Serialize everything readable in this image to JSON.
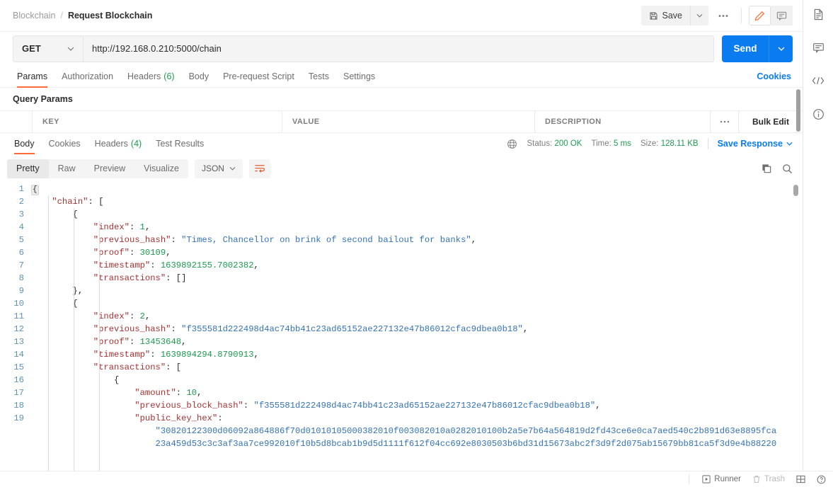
{
  "header": {
    "breadcrumb_parent": "Blockchain",
    "breadcrumb_separator": "/",
    "breadcrumb_current": "Request Blockchain",
    "save_label": "Save",
    "more_label": "●●●",
    "edit_icon": "pencil-icon",
    "comment_icon": "comment-icon"
  },
  "request": {
    "method": "GET",
    "url": "http://192.168.0.210:5000/chain",
    "send_label": "Send",
    "tabs": [
      {
        "label": "Params",
        "count": "",
        "active": true
      },
      {
        "label": "Authorization",
        "count": "",
        "active": false
      },
      {
        "label": "Headers",
        "count": "(6)",
        "active": false
      },
      {
        "label": "Body",
        "count": "",
        "active": false
      },
      {
        "label": "Pre-request Script",
        "count": "",
        "active": false
      },
      {
        "label": "Tests",
        "count": "",
        "active": false
      },
      {
        "label": "Settings",
        "count": "",
        "active": false
      }
    ],
    "cookies_link": "Cookies"
  },
  "query_params": {
    "title": "Query Params",
    "columns": [
      "KEY",
      "VALUE",
      "DESCRIPTION"
    ],
    "bulk_edit": "Bulk Edit",
    "dots": "●●●",
    "rows": []
  },
  "response": {
    "tabs": [
      {
        "label": "Body",
        "count": "",
        "active": true
      },
      {
        "label": "Cookies",
        "count": "",
        "active": false
      },
      {
        "label": "Headers",
        "count": "(4)",
        "active": false
      },
      {
        "label": "Test Results",
        "count": "",
        "active": false
      }
    ],
    "status_label": "Status:",
    "status_value": "200 OK",
    "time_label": "Time:",
    "time_value": "5 ms",
    "size_label": "Size:",
    "size_value": "128.11 KB",
    "save_response": "Save Response",
    "format_tabs": [
      {
        "label": "Pretty",
        "active": true
      },
      {
        "label": "Raw",
        "active": false
      },
      {
        "label": "Preview",
        "active": false
      },
      {
        "label": "Visualize",
        "active": false
      }
    ],
    "content_type": "JSON",
    "wrap_icon": "word-wrap-icon",
    "copy_icon": "copy-icon",
    "search_icon": "search-icon",
    "globe_icon": "globe-icon"
  },
  "body_lines": [
    {
      "num": "1",
      "indent": 0,
      "fold": "{"
    },
    {
      "num": "2",
      "indent": 1,
      "tokens": [
        {
          "t": "k",
          "v": "\"chain\""
        },
        {
          "t": "p",
          "v": ": ["
        }
      ]
    },
    {
      "num": "3",
      "indent": 2,
      "tokens": [
        {
          "t": "p",
          "v": "{"
        }
      ]
    },
    {
      "num": "4",
      "indent": 3,
      "tokens": [
        {
          "t": "k",
          "v": "\"index\""
        },
        {
          "t": "p",
          "v": ": "
        },
        {
          "t": "n",
          "v": "1"
        },
        {
          "t": "p",
          "v": ","
        }
      ]
    },
    {
      "num": "5",
      "indent": 3,
      "tokens": [
        {
          "t": "k",
          "v": "\"previous_hash\""
        },
        {
          "t": "p",
          "v": ": "
        },
        {
          "t": "s",
          "v": "\"Times, Chancellor on brink of second bailout for banks\""
        },
        {
          "t": "p",
          "v": ","
        }
      ]
    },
    {
      "num": "6",
      "indent": 3,
      "tokens": [
        {
          "t": "k",
          "v": "\"proof\""
        },
        {
          "t": "p",
          "v": ": "
        },
        {
          "t": "n",
          "v": "30109"
        },
        {
          "t": "p",
          "v": ","
        }
      ]
    },
    {
      "num": "7",
      "indent": 3,
      "tokens": [
        {
          "t": "k",
          "v": "\"timestamp\""
        },
        {
          "t": "p",
          "v": ": "
        },
        {
          "t": "n",
          "v": "1639892155.7002382"
        },
        {
          "t": "p",
          "v": ","
        }
      ]
    },
    {
      "num": "8",
      "indent": 3,
      "tokens": [
        {
          "t": "k",
          "v": "\"transactions\""
        },
        {
          "t": "p",
          "v": ": []"
        }
      ]
    },
    {
      "num": "9",
      "indent": 2,
      "tokens": [
        {
          "t": "p",
          "v": "},"
        }
      ]
    },
    {
      "num": "10",
      "indent": 2,
      "tokens": [
        {
          "t": "p",
          "v": "{"
        }
      ]
    },
    {
      "num": "11",
      "indent": 3,
      "tokens": [
        {
          "t": "k",
          "v": "\"index\""
        },
        {
          "t": "p",
          "v": ": "
        },
        {
          "t": "n",
          "v": "2"
        },
        {
          "t": "p",
          "v": ","
        }
      ]
    },
    {
      "num": "12",
      "indent": 3,
      "tokens": [
        {
          "t": "k",
          "v": "\"previous_hash\""
        },
        {
          "t": "p",
          "v": ": "
        },
        {
          "t": "s",
          "v": "\"f355581d222498d4ac74bb41c23ad65152ae227132e47b86012cfac9dbea0b18\""
        },
        {
          "t": "p",
          "v": ","
        }
      ]
    },
    {
      "num": "13",
      "indent": 3,
      "tokens": [
        {
          "t": "k",
          "v": "\"proof\""
        },
        {
          "t": "p",
          "v": ": "
        },
        {
          "t": "n",
          "v": "13453648"
        },
        {
          "t": "p",
          "v": ","
        }
      ]
    },
    {
      "num": "14",
      "indent": 3,
      "tokens": [
        {
          "t": "k",
          "v": "\"timestamp\""
        },
        {
          "t": "p",
          "v": ": "
        },
        {
          "t": "n",
          "v": "1639894294.8790913"
        },
        {
          "t": "p",
          "v": ","
        }
      ]
    },
    {
      "num": "15",
      "indent": 3,
      "tokens": [
        {
          "t": "k",
          "v": "\"transactions\""
        },
        {
          "t": "p",
          "v": ": ["
        }
      ]
    },
    {
      "num": "16",
      "indent": 4,
      "tokens": [
        {
          "t": "p",
          "v": "{"
        }
      ]
    },
    {
      "num": "17",
      "indent": 5,
      "tokens": [
        {
          "t": "k",
          "v": "\"amount\""
        },
        {
          "t": "p",
          "v": ": "
        },
        {
          "t": "n",
          "v": "10"
        },
        {
          "t": "p",
          "v": ","
        }
      ]
    },
    {
      "num": "18",
      "indent": 5,
      "tokens": [
        {
          "t": "k",
          "v": "\"previous_block_hash\""
        },
        {
          "t": "p",
          "v": ": "
        },
        {
          "t": "s",
          "v": "\"f355581d222498d4ac74bb41c23ad65152ae227132e47b86012cfac9dbea0b18\""
        },
        {
          "t": "p",
          "v": ","
        }
      ]
    },
    {
      "num": "19",
      "indent": 5,
      "tokens": [
        {
          "t": "k",
          "v": "\"public_key_hex\""
        },
        {
          "t": "p",
          "v": ":"
        }
      ]
    },
    {
      "num": "",
      "indent": 6,
      "tokens": [
        {
          "t": "s",
          "v": "\"30820122300d06092a864886f70d01010105000382010f003082010a0282010100b2a5e7b64a564819d2fd43ce6e0ca7aed540c2b891d63e8895fca"
        }
      ]
    },
    {
      "num": "",
      "indent": 6,
      "tokens": [
        {
          "t": "s",
          "v": "23a459d53c3c3af3aa7ce992010f10b5d8bcab1b9d5d1111f612f04cc692e8030503b6bd31d15673abc2f3d9f2d075ab15679bb81ca5f3d9e4b88220"
        }
      ]
    }
  ],
  "footer": {
    "runner": "Runner",
    "trash": "Trash",
    "layout_icon": "layout-icon",
    "help_icon": "help-icon"
  },
  "right_rail": [
    {
      "icon": "documentation-icon"
    },
    {
      "icon": "comment-icon"
    },
    {
      "icon": "code-icon"
    },
    {
      "icon": "info-icon"
    }
  ]
}
